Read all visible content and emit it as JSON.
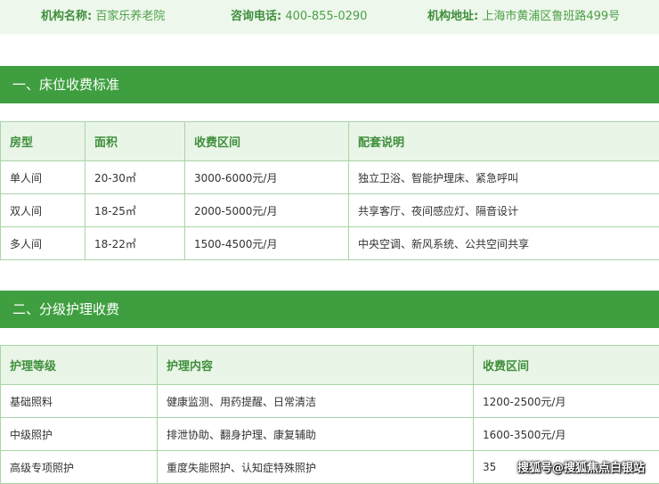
{
  "info": {
    "name_label": "机构名称:",
    "name_value": "百家乐养老院",
    "phone_label": "咨询电话:",
    "phone_value": "400-855-0290",
    "address_label": "机构地址:",
    "address_value": "上海市黄浦区鲁班路499号"
  },
  "section1": {
    "title": "一、床位收费标准",
    "headers": [
      "房型",
      "面积",
      "收费区间",
      "配套说明"
    ],
    "rows": [
      [
        "单人间",
        "20-30㎡",
        "3000-6000元/月",
        "独立卫浴、智能护理床、紧急呼叫"
      ],
      [
        "双人间",
        "18-25㎡",
        "2000-5000元/月",
        "共享客厅、夜间感应灯、隔音设计"
      ],
      [
        "多人间",
        "18-22㎡",
        "1500-4500元/月",
        "中央空调、新风系统、公共空间共享"
      ]
    ]
  },
  "section2": {
    "title": "二、分级护理收费",
    "headers": [
      "护理等级",
      "护理内容",
      "收费区间"
    ],
    "rows": [
      [
        "基础照料",
        "健康监测、用药提醒、日常清洁",
        "1200-2500元/月"
      ],
      [
        "中级照护",
        "排泄协助、翻身护理、康复辅助",
        "1600-3500元/月"
      ],
      [
        "高级专项照护",
        "重度失能照护、认知症特殊照护",
        "35"
      ]
    ]
  },
  "watermark": "搜狐号@搜狐焦点白银站",
  "colors": {
    "accent": "#3f9f40",
    "info_background": "#eef7ec",
    "header_background": "#e9f5e7",
    "border": "#a9d5a6"
  }
}
